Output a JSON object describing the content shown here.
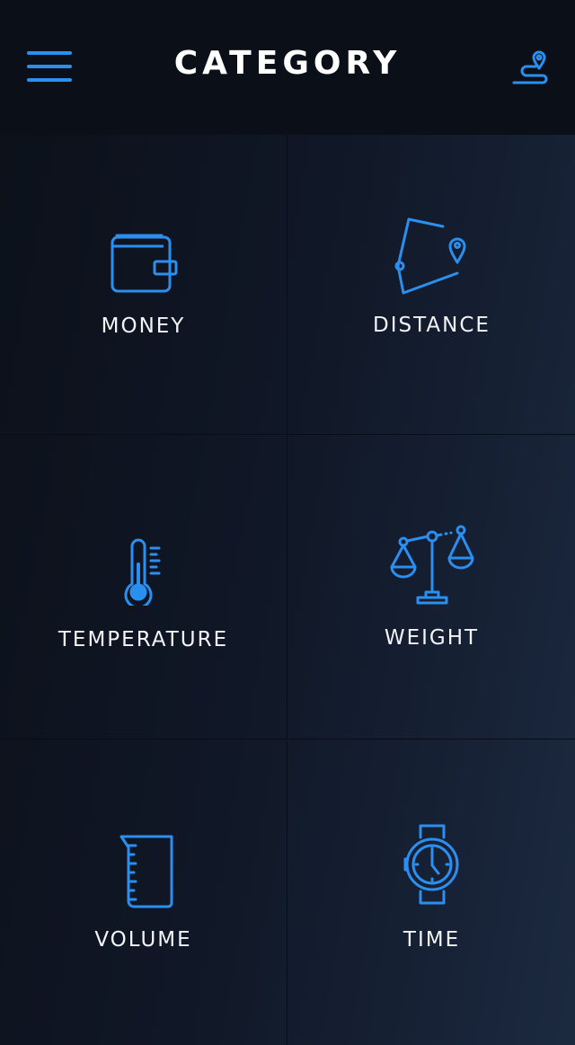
{
  "header": {
    "title": "CATEGORY",
    "menu_icon": "hamburger-menu-icon",
    "route_icon": "route-pin-icon"
  },
  "accent_color": "#2b8ff0",
  "categories": [
    {
      "label": "MONEY",
      "icon": "wallet-icon"
    },
    {
      "label": "DISTANCE",
      "icon": "map-pin-distance-icon"
    },
    {
      "label": "TEMPERATURE",
      "icon": "thermometer-icon"
    },
    {
      "label": "WEIGHT",
      "icon": "balance-scale-icon"
    },
    {
      "label": "VOLUME",
      "icon": "measuring-beaker-icon"
    },
    {
      "label": "TIME",
      "icon": "wristwatch-icon"
    }
  ]
}
